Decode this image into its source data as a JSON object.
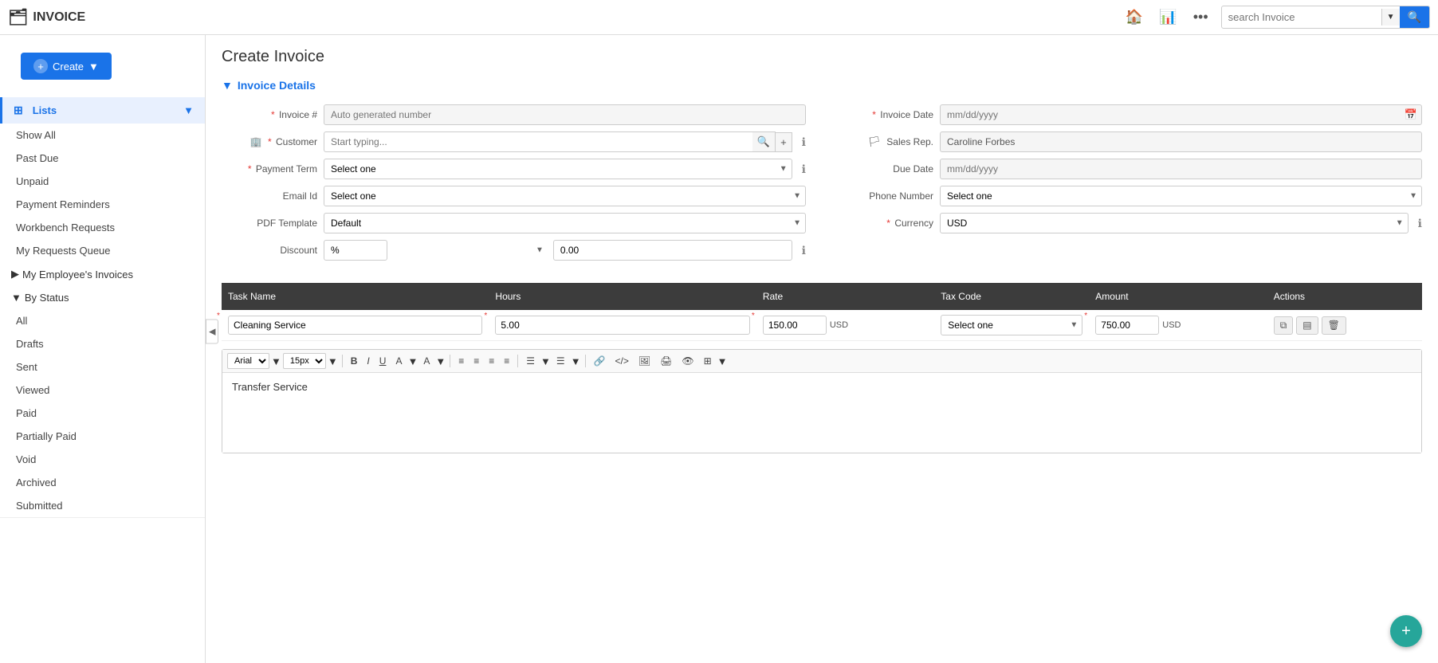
{
  "app": {
    "logo_icon": "🗂",
    "title": "INVOICE",
    "search_placeholder": "search Invoice",
    "nav_icons": [
      "🏠",
      "📊",
      "•••"
    ]
  },
  "sidebar": {
    "create_label": "Create",
    "lists_label": "Lists",
    "items": [
      {
        "label": "Show All"
      },
      {
        "label": "Past Due"
      },
      {
        "label": "Unpaid"
      },
      {
        "label": "Payment Reminders"
      },
      {
        "label": "Workbench Requests"
      },
      {
        "label": "My Requests Queue"
      },
      {
        "label": "My Employee's Invoices"
      }
    ],
    "by_status_label": "By Status",
    "status_items": [
      {
        "label": "All"
      },
      {
        "label": "Drafts"
      },
      {
        "label": "Sent"
      },
      {
        "label": "Viewed"
      },
      {
        "label": "Paid"
      },
      {
        "label": "Partially Paid"
      },
      {
        "label": "Void"
      },
      {
        "label": "Archived"
      },
      {
        "label": "Submitted"
      }
    ]
  },
  "main": {
    "page_title": "Create Invoice",
    "section_title": "Invoice Details",
    "form": {
      "invoice_num_label": "Invoice #",
      "invoice_num_placeholder": "Auto generated number",
      "invoice_date_label": "Invoice Date",
      "invoice_date_placeholder": "mm/dd/yyyy",
      "customer_label": "Customer",
      "customer_placeholder": "Start typing...",
      "sales_rep_label": "Sales Rep.",
      "sales_rep_value": "Caroline Forbes",
      "payment_term_label": "Payment Term",
      "payment_term_placeholder": "Select one",
      "due_date_label": "Due Date",
      "due_date_placeholder": "mm/dd/yyyy",
      "email_id_label": "Email Id",
      "email_id_placeholder": "Select one",
      "phone_number_label": "Phone Number",
      "phone_number_placeholder": "Select one",
      "pdf_template_label": "PDF Template",
      "pdf_template_value": "Default",
      "currency_label": "Currency",
      "currency_value": "USD",
      "discount_label": "Discount",
      "discount_type": "%",
      "discount_value": "0.00"
    },
    "table": {
      "columns": [
        "Task Name",
        "Hours",
        "Rate",
        "Tax Code",
        "Amount",
        "Actions"
      ],
      "rows": [
        {
          "task_name": "Cleaning Service",
          "hours": "5.00",
          "rate": "150.00",
          "rate_currency": "USD",
          "tax_code_placeholder": "Select one",
          "amount": "750.00",
          "amount_currency": "USD"
        }
      ]
    },
    "editor": {
      "font_family": "Arial",
      "font_size": "15px",
      "content": "Transfer Service",
      "toolbar_buttons": [
        "B",
        "I",
        "U",
        "A",
        "A"
      ]
    }
  }
}
